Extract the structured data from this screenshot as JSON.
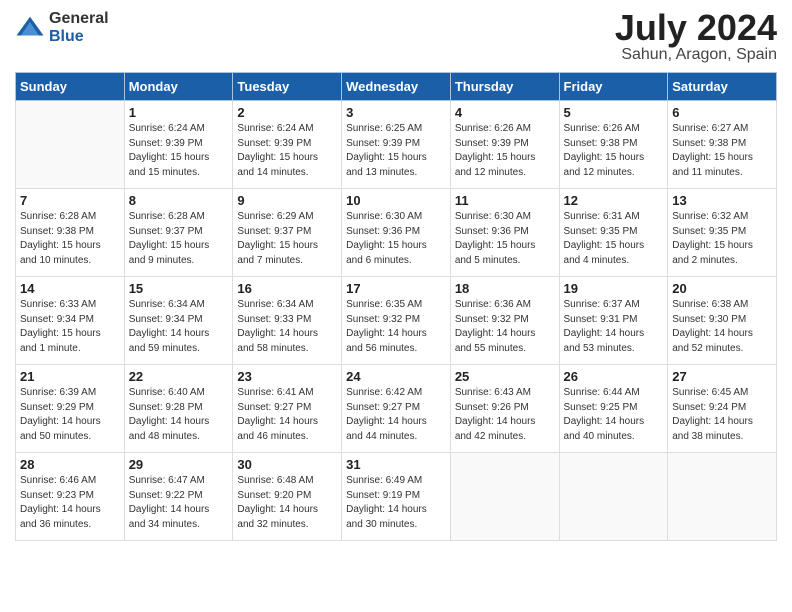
{
  "header": {
    "logo_general": "General",
    "logo_blue": "Blue",
    "month": "July 2024",
    "location": "Sahun, Aragon, Spain"
  },
  "days_of_week": [
    "Sunday",
    "Monday",
    "Tuesday",
    "Wednesday",
    "Thursday",
    "Friday",
    "Saturday"
  ],
  "weeks": [
    [
      {
        "day": "",
        "info": ""
      },
      {
        "day": "1",
        "info": "Sunrise: 6:24 AM\nSunset: 9:39 PM\nDaylight: 15 hours\nand 15 minutes."
      },
      {
        "day": "2",
        "info": "Sunrise: 6:24 AM\nSunset: 9:39 PM\nDaylight: 15 hours\nand 14 minutes."
      },
      {
        "day": "3",
        "info": "Sunrise: 6:25 AM\nSunset: 9:39 PM\nDaylight: 15 hours\nand 13 minutes."
      },
      {
        "day": "4",
        "info": "Sunrise: 6:26 AM\nSunset: 9:39 PM\nDaylight: 15 hours\nand 12 minutes."
      },
      {
        "day": "5",
        "info": "Sunrise: 6:26 AM\nSunset: 9:38 PM\nDaylight: 15 hours\nand 12 minutes."
      },
      {
        "day": "6",
        "info": "Sunrise: 6:27 AM\nSunset: 9:38 PM\nDaylight: 15 hours\nand 11 minutes."
      }
    ],
    [
      {
        "day": "7",
        "info": "Sunrise: 6:28 AM\nSunset: 9:38 PM\nDaylight: 15 hours\nand 10 minutes."
      },
      {
        "day": "8",
        "info": "Sunrise: 6:28 AM\nSunset: 9:37 PM\nDaylight: 15 hours\nand 9 minutes."
      },
      {
        "day": "9",
        "info": "Sunrise: 6:29 AM\nSunset: 9:37 PM\nDaylight: 15 hours\nand 7 minutes."
      },
      {
        "day": "10",
        "info": "Sunrise: 6:30 AM\nSunset: 9:36 PM\nDaylight: 15 hours\nand 6 minutes."
      },
      {
        "day": "11",
        "info": "Sunrise: 6:30 AM\nSunset: 9:36 PM\nDaylight: 15 hours\nand 5 minutes."
      },
      {
        "day": "12",
        "info": "Sunrise: 6:31 AM\nSunset: 9:35 PM\nDaylight: 15 hours\nand 4 minutes."
      },
      {
        "day": "13",
        "info": "Sunrise: 6:32 AM\nSunset: 9:35 PM\nDaylight: 15 hours\nand 2 minutes."
      }
    ],
    [
      {
        "day": "14",
        "info": "Sunrise: 6:33 AM\nSunset: 9:34 PM\nDaylight: 15 hours\nand 1 minute."
      },
      {
        "day": "15",
        "info": "Sunrise: 6:34 AM\nSunset: 9:34 PM\nDaylight: 14 hours\nand 59 minutes."
      },
      {
        "day": "16",
        "info": "Sunrise: 6:34 AM\nSunset: 9:33 PM\nDaylight: 14 hours\nand 58 minutes."
      },
      {
        "day": "17",
        "info": "Sunrise: 6:35 AM\nSunset: 9:32 PM\nDaylight: 14 hours\nand 56 minutes."
      },
      {
        "day": "18",
        "info": "Sunrise: 6:36 AM\nSunset: 9:32 PM\nDaylight: 14 hours\nand 55 minutes."
      },
      {
        "day": "19",
        "info": "Sunrise: 6:37 AM\nSunset: 9:31 PM\nDaylight: 14 hours\nand 53 minutes."
      },
      {
        "day": "20",
        "info": "Sunrise: 6:38 AM\nSunset: 9:30 PM\nDaylight: 14 hours\nand 52 minutes."
      }
    ],
    [
      {
        "day": "21",
        "info": "Sunrise: 6:39 AM\nSunset: 9:29 PM\nDaylight: 14 hours\nand 50 minutes."
      },
      {
        "day": "22",
        "info": "Sunrise: 6:40 AM\nSunset: 9:28 PM\nDaylight: 14 hours\nand 48 minutes."
      },
      {
        "day": "23",
        "info": "Sunrise: 6:41 AM\nSunset: 9:27 PM\nDaylight: 14 hours\nand 46 minutes."
      },
      {
        "day": "24",
        "info": "Sunrise: 6:42 AM\nSunset: 9:27 PM\nDaylight: 14 hours\nand 44 minutes."
      },
      {
        "day": "25",
        "info": "Sunrise: 6:43 AM\nSunset: 9:26 PM\nDaylight: 14 hours\nand 42 minutes."
      },
      {
        "day": "26",
        "info": "Sunrise: 6:44 AM\nSunset: 9:25 PM\nDaylight: 14 hours\nand 40 minutes."
      },
      {
        "day": "27",
        "info": "Sunrise: 6:45 AM\nSunset: 9:24 PM\nDaylight: 14 hours\nand 38 minutes."
      }
    ],
    [
      {
        "day": "28",
        "info": "Sunrise: 6:46 AM\nSunset: 9:23 PM\nDaylight: 14 hours\nand 36 minutes."
      },
      {
        "day": "29",
        "info": "Sunrise: 6:47 AM\nSunset: 9:22 PM\nDaylight: 14 hours\nand 34 minutes."
      },
      {
        "day": "30",
        "info": "Sunrise: 6:48 AM\nSunset: 9:20 PM\nDaylight: 14 hours\nand 32 minutes."
      },
      {
        "day": "31",
        "info": "Sunrise: 6:49 AM\nSunset: 9:19 PM\nDaylight: 14 hours\nand 30 minutes."
      },
      {
        "day": "",
        "info": ""
      },
      {
        "day": "",
        "info": ""
      },
      {
        "day": "",
        "info": ""
      }
    ]
  ]
}
